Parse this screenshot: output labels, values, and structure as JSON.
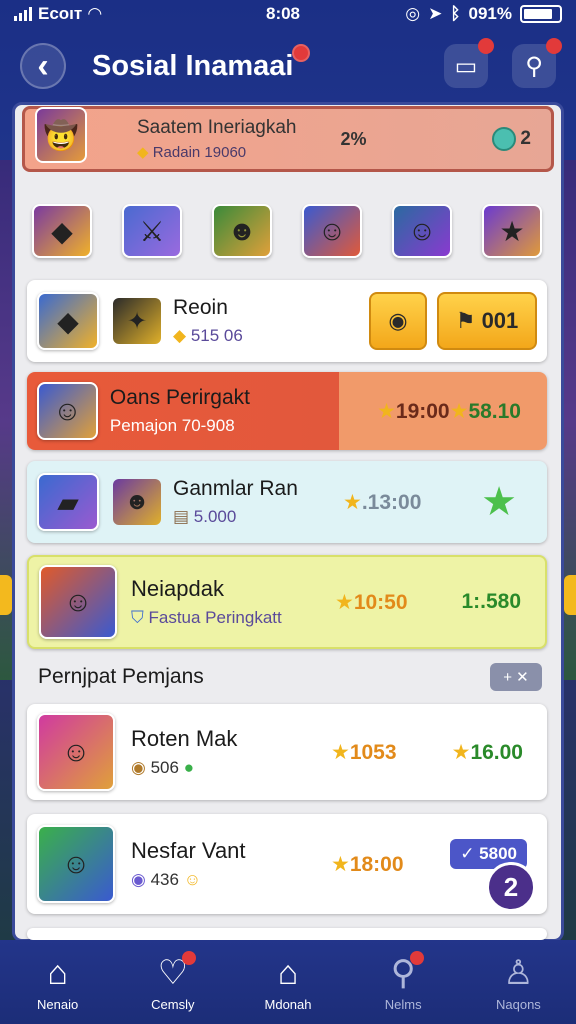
{
  "status_bar": {
    "carrier": "Eᴄoıт",
    "time": "8:08",
    "battery": "091%"
  },
  "header": {
    "title": "Sosial Inamaai"
  },
  "rank_banner": {
    "title": "Saatem Ineriagkah",
    "subtitle": "Radain 19060",
    "value": "2%",
    "badge": "2"
  },
  "cards": [
    {
      "name": "Reoin",
      "sub": "515 06",
      "button_value": "001"
    },
    {
      "name": "Oans Perirgakt",
      "sub": "Pemajon 70-908",
      "value1": "19:00",
      "value2": "58.10"
    },
    {
      "name": "Ganmlar Ran",
      "sub": "5.000",
      "value1": ".13:00"
    },
    {
      "name": "Neiapdak",
      "sub": "Fastua Peringkatt",
      "value1": "10:50",
      "value2": "1:.580"
    }
  ],
  "section": {
    "title": "Pernjpat Pemjans",
    "ctrl": "+ ✕"
  },
  "players": [
    {
      "name": "Roten Mak",
      "sub": "506",
      "value1": "1053",
      "value2": "16.00"
    },
    {
      "name": "Nesfar Vant",
      "sub": "436",
      "value1": "18:00",
      "pill": "✓ 5800"
    }
  ],
  "fab": "2",
  "nav": [
    {
      "label": "Nenaio",
      "icon": "home-icon",
      "glyph": "⌂"
    },
    {
      "label": "Cemsly",
      "icon": "heart-shield-icon",
      "glyph": "♡"
    },
    {
      "label": "Mdonah",
      "icon": "house-outline-icon",
      "glyph": "⌂"
    },
    {
      "label": "Nelms",
      "icon": "search-user-icon",
      "glyph": "⚲"
    },
    {
      "label": "Naqons",
      "icon": "profile-icon",
      "glyph": "♙"
    }
  ],
  "colors": {
    "primary": "#23358a",
    "accent": "#f3b91e",
    "alert": "#e23a3a"
  }
}
